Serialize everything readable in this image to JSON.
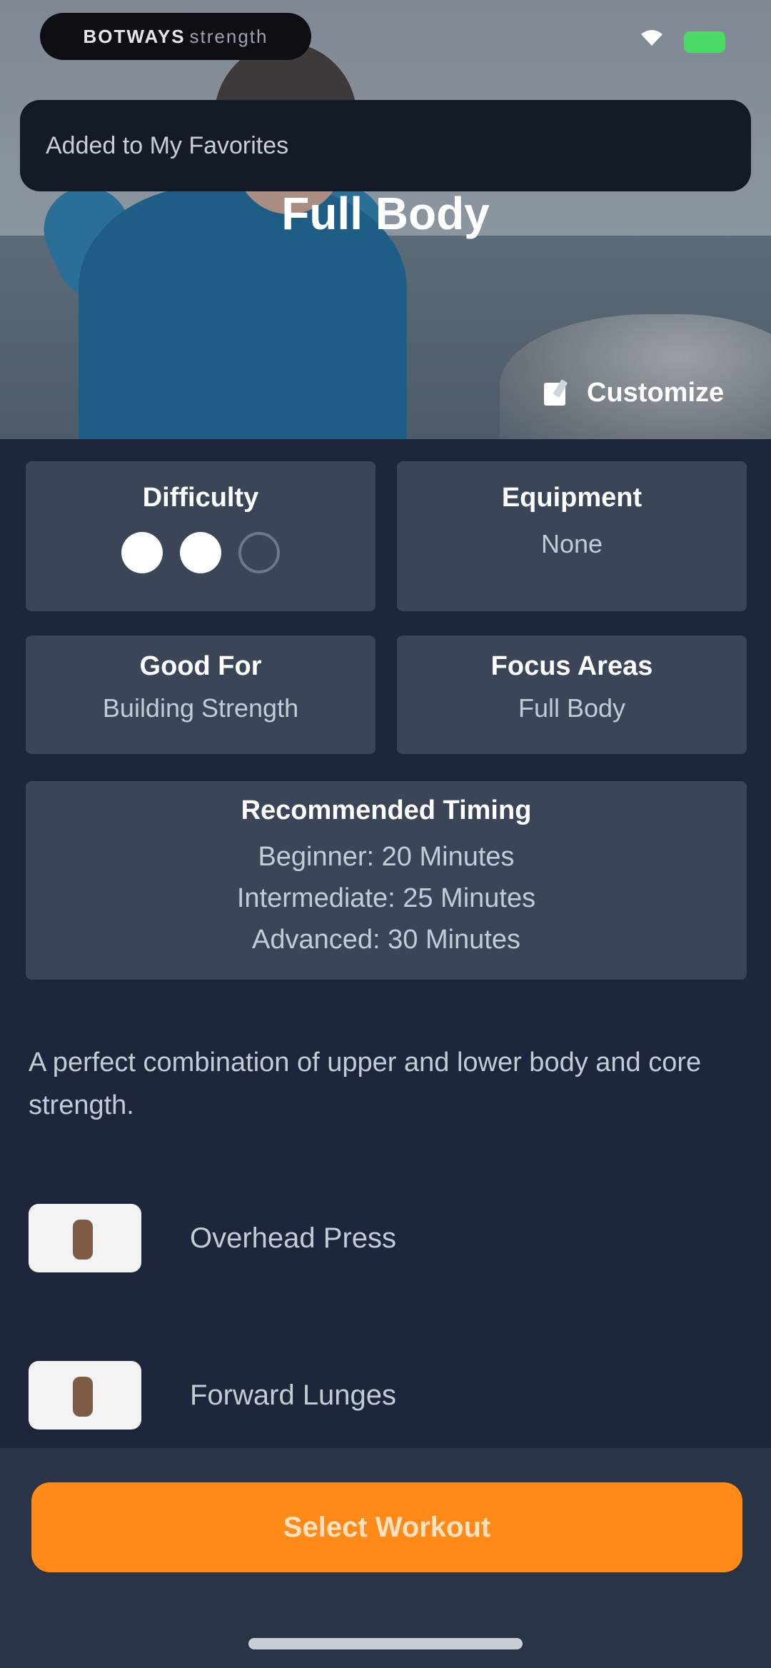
{
  "status_bar": {
    "brand_text_bold": "BOTWAYS",
    "brand_text_light": "strength",
    "battery_color": "#4cd964"
  },
  "toast": {
    "message": "Added to My Favorites"
  },
  "hero": {
    "title": "Full Body",
    "customize_label": "Customize",
    "customize_icon": "edit-icon"
  },
  "details": {
    "difficulty": {
      "label": "Difficulty",
      "level": 2,
      "max": 3
    },
    "equipment": {
      "label": "Equipment",
      "value": "None"
    },
    "good_for": {
      "label": "Good For",
      "value": "Building Strength"
    },
    "focus_areas": {
      "label": "Focus Areas",
      "value": "Full Body"
    },
    "timing": {
      "label": "Recommended Timing",
      "lines": [
        "Beginner: 20 Minutes",
        "Intermediate: 25 Minutes",
        "Advanced: 30 Minutes"
      ]
    }
  },
  "description": "A perfect combination of upper and lower body and core strength.",
  "exercises": [
    {
      "name": "Overhead Press"
    },
    {
      "name": "Forward Lunges"
    }
  ],
  "cta": {
    "label": "Select Workout",
    "color": "#ff8a18"
  }
}
